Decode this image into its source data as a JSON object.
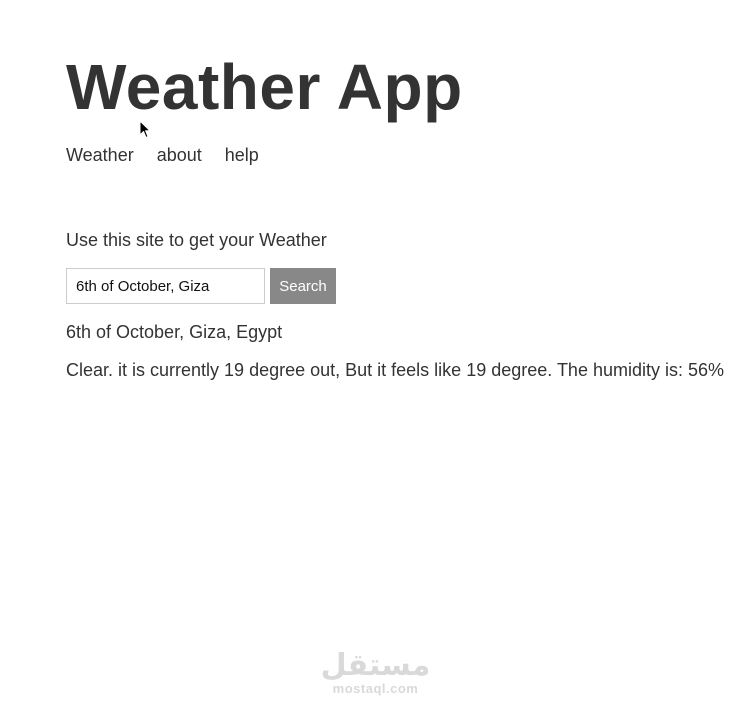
{
  "header": {
    "title": "Weather App"
  },
  "nav": {
    "items": [
      {
        "label": "Weather"
      },
      {
        "label": "about"
      },
      {
        "label": "help"
      }
    ]
  },
  "main": {
    "intro": "Use this site to get your Weather",
    "search": {
      "value": "6th of October, Giza",
      "button_label": "Search"
    },
    "result": {
      "location": "6th of October, Giza, Egypt",
      "forecast": "Clear. it is currently 19 degree out, But it feels like 19 degree. The humidity is: 56%"
    }
  },
  "watermark": {
    "logo": "مستقل",
    "site": "mostaql.com"
  },
  "icons": {
    "cursor": "mouse-pointer-icon"
  }
}
